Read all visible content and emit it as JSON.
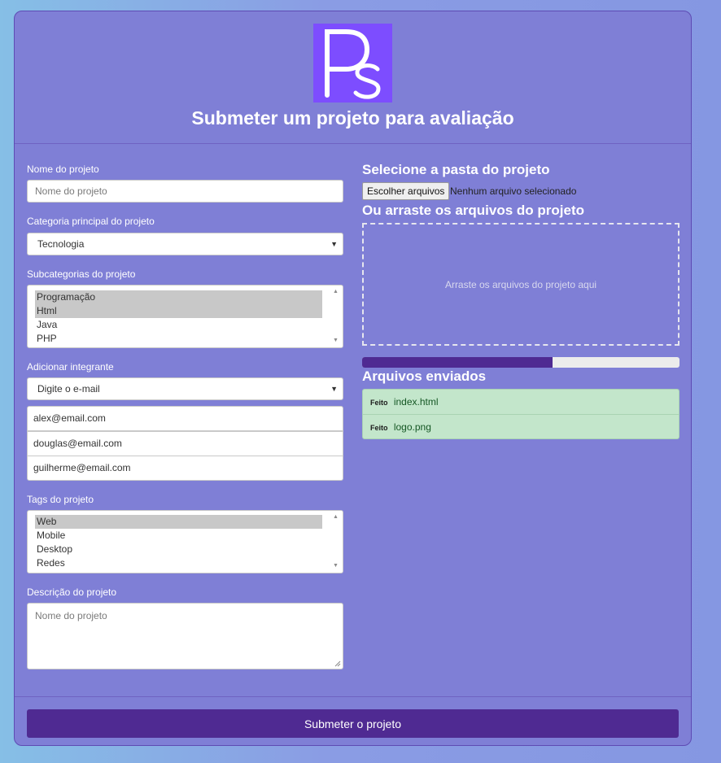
{
  "header": {
    "title": "Submeter um projeto para avaliação",
    "logo_text": "Ps",
    "logo_color": "#7d4dff"
  },
  "form": {
    "project_name": {
      "label": "Nome do projeto",
      "placeholder": "Nome do projeto",
      "value": ""
    },
    "main_category": {
      "label": "Categoria principal do projeto",
      "selected": "Tecnologia"
    },
    "subcategories": {
      "label": "Subcategorias do projeto",
      "options": [
        {
          "label": "Programação",
          "selected": true
        },
        {
          "label": "Html",
          "selected": true
        },
        {
          "label": "Java",
          "selected": false
        },
        {
          "label": "PHP",
          "selected": false
        }
      ]
    },
    "add_member": {
      "label": "Adicionar integrante",
      "selected": "Digite o e-mail",
      "members": [
        "alex@email.com",
        "douglas@email.com",
        "guilherme@email.com"
      ]
    },
    "tags": {
      "label": "Tags do projeto",
      "options": [
        {
          "label": "Web",
          "selected": true
        },
        {
          "label": "Mobile",
          "selected": false
        },
        {
          "label": "Desktop",
          "selected": false
        },
        {
          "label": "Redes",
          "selected": false
        }
      ]
    },
    "description": {
      "label": "Descrição do projeto",
      "placeholder": "Nome do projeto",
      "value": ""
    }
  },
  "upload": {
    "select_folder_title": "Selecione a pasta do projeto",
    "choose_button": "Escolher arquivos",
    "no_file": "Nenhum arquivo selecionado",
    "drag_title": "Ou arraste os arquivos do projeto",
    "dropzone_text": "Arraste os arquivos do projeto aqui",
    "progress_percent": 60,
    "uploaded_title": "Arquivos enviados",
    "files": [
      {
        "badge": "Feito",
        "name": "index.html"
      },
      {
        "badge": "Feito",
        "name": "logo.png"
      }
    ]
  },
  "footer": {
    "submit_label": "Submeter o projeto"
  },
  "colors": {
    "card_background": "#7f7fd6",
    "accent": "#4f2a92",
    "success_background": "#c3e6cb"
  }
}
